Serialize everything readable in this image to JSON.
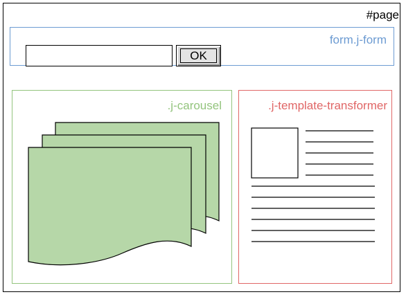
{
  "page": {
    "label": "#page"
  },
  "form": {
    "label": "form.j-form",
    "input_value": "",
    "ok_label": "OK"
  },
  "carousel": {
    "label": ".j-carousel",
    "slide_count": 3
  },
  "template_transformer": {
    "label": ".j-template-transformer",
    "side_line_count": 5,
    "full_line_count": 6
  },
  "colors": {
    "page": "#000000",
    "form": "#6c9bd2",
    "carousel": "#93c47d",
    "carousel_fill": "#b6d7a8",
    "transformer": "#e06666"
  }
}
